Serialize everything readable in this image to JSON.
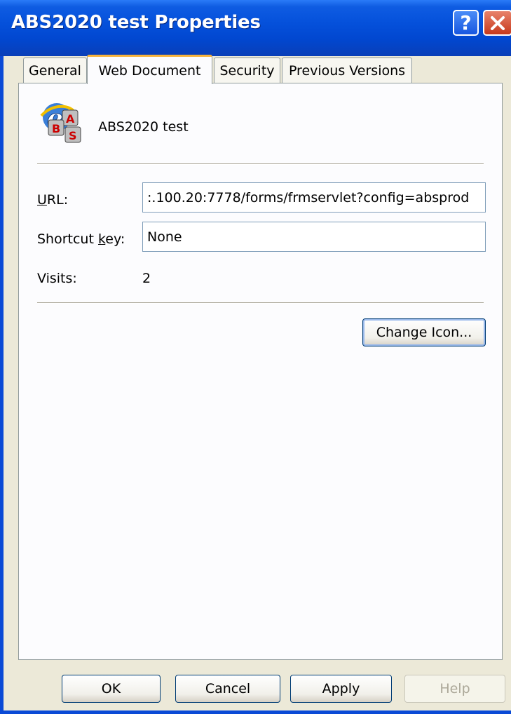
{
  "window": {
    "title": "ABS2020 test Properties"
  },
  "tabs": [
    {
      "label": "General"
    },
    {
      "label": "Web Document"
    },
    {
      "label": "Security"
    },
    {
      "label": "Previous Versions"
    }
  ],
  "header": {
    "name": "ABS2020 test",
    "icon": "internet-shortcut-icon"
  },
  "fields": {
    "url_label": "URL:",
    "url_value": ":.100.20:7778/forms/frmservlet?config=absprod",
    "shortcut_label": "Shortcut key:",
    "shortcut_value": "None",
    "visits_label": "Visits:",
    "visits_value": "2"
  },
  "change_icon_label": "Change Icon...",
  "buttons": {
    "ok": "OK",
    "cancel": "Cancel",
    "apply": "Apply",
    "help": "Help"
  },
  "colors": {
    "titlebar": "#0551db",
    "face": "#ECE9D8",
    "tab_highlight": "#f8b33c"
  }
}
